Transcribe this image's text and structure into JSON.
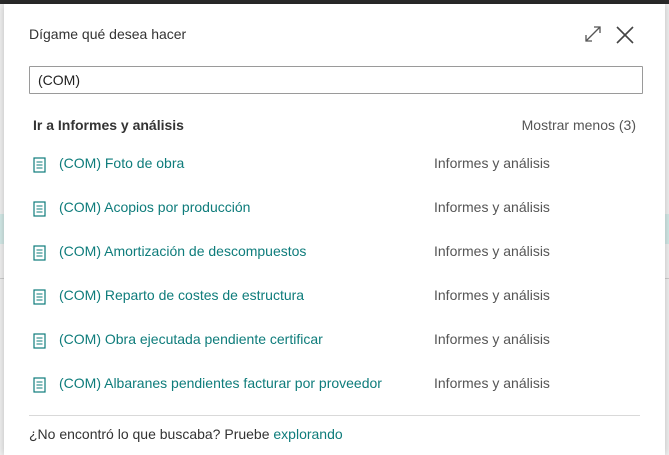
{
  "dialog": {
    "title": "Dígame qué desea hacer"
  },
  "search": {
    "value": "(COM)"
  },
  "section": {
    "header": "Ir a Informes y análisis",
    "toggle_label": "Mostrar menos (3)"
  },
  "results": [
    {
      "label": "(COM) Foto de obra",
      "category": "Informes y análisis"
    },
    {
      "label": "(COM) Acopios por producción",
      "category": "Informes y análisis"
    },
    {
      "label": "(COM) Amortización de descompuestos",
      "category": "Informes y análisis"
    },
    {
      "label": "(COM) Reparto de costes de estructura",
      "category": "Informes y análisis"
    },
    {
      "label": "(COM) Obra ejecutada pendiente certificar",
      "category": "Informes y análisis"
    },
    {
      "label": "(COM) Albaranes pendientes facturar por proveedor",
      "category": "Informes y análisis"
    }
  ],
  "footer": {
    "text": "¿No encontró lo que buscaba? Pruebe ",
    "link": "explorando"
  },
  "colors": {
    "accent": "#0e7c7b",
    "text": "#333333",
    "muted": "#555555"
  },
  "icons": {
    "result": "report-document-icon",
    "expand": "expand-icon",
    "close": "close-icon"
  }
}
